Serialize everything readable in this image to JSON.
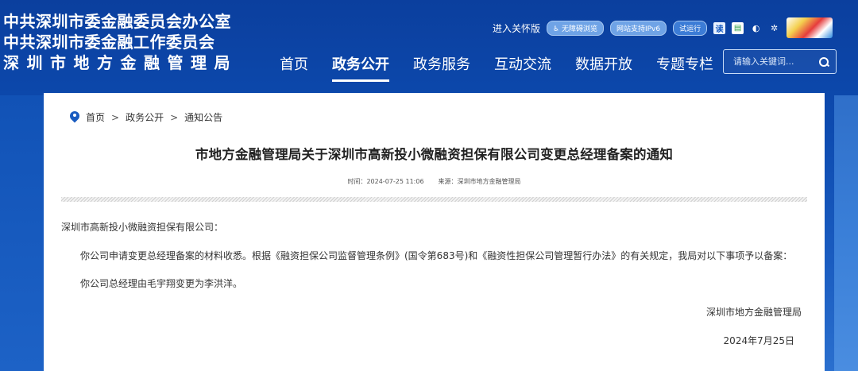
{
  "header": {
    "org_names": [
      "中共深圳市委金融委员会办公室",
      "中共深圳市委金融工作委员会",
      "深圳市地方金融管理局"
    ],
    "care_version": "进入关怀版",
    "accessibility_badge": "无障碍浏览",
    "ipv6_badge": "网站支持IPv6",
    "trial_badge": "试运行",
    "read_icon_label": "读"
  },
  "nav": {
    "items": [
      "首页",
      "政务公开",
      "政务服务",
      "互动交流",
      "数据开放",
      "专题专栏"
    ],
    "active_index": 1
  },
  "search": {
    "placeholder": "请输入关键词..."
  },
  "breadcrumb": {
    "items": [
      "首页",
      "政务公开",
      "通知公告"
    ],
    "separator": ">"
  },
  "article": {
    "title": "市地方金融管理局关于深圳市高新投小微融资担保有限公司变更总经理备案的通知",
    "time_label": "时间：2024-07-25 11:06",
    "source_label": "来源：深圳市地方金融管理局",
    "salutation": "深圳市高新投小微融资担保有限公司：",
    "paragraph1": "你公司申请变更总经理备案的材料收悉。根据《融资担保公司监督管理条例》(国令第683号)和《融资性担保公司管理暂行办法》的有关规定，我局对以下事项予以备案：",
    "paragraph2": "你公司总经理由毛宇翔变更为李洪洋。",
    "signature": "深圳市地方金融管理局",
    "date": "2024年7月25日"
  },
  "colors": {
    "brand_blue": "#0d4bb0",
    "card_bg": "#ffffff"
  }
}
